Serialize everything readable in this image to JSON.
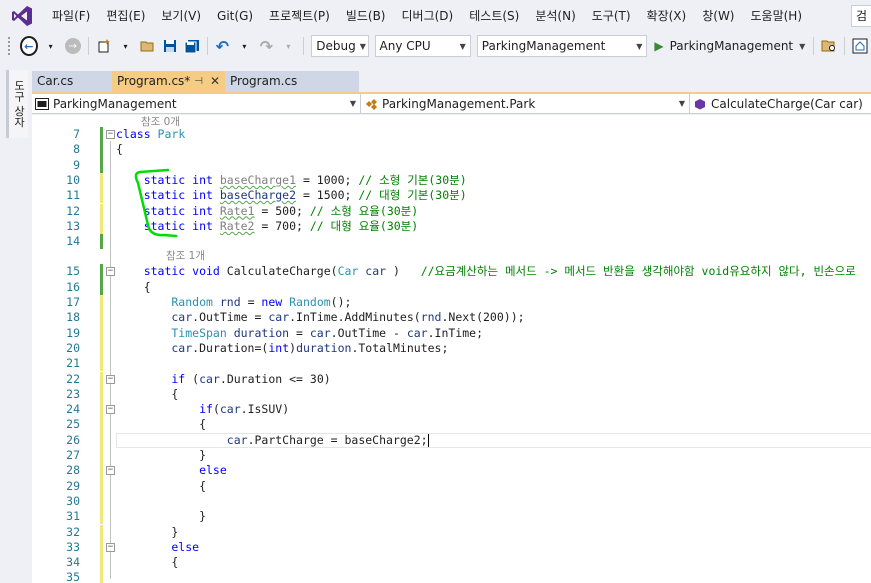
{
  "menubar": {
    "items": [
      "파일(F)",
      "편집(E)",
      "보기(V)",
      "Git(G)",
      "프로젝트(P)",
      "빌드(B)",
      "디버그(D)",
      "테스트(S)",
      "분석(N)",
      "도구(T)",
      "확장(X)",
      "창(W)",
      "도움말(H)"
    ],
    "search_text": "검"
  },
  "toolbar": {
    "configuration": "Debug",
    "platform": "Any CPU",
    "startup_project": "ParkingManagement",
    "run_label": "ParkingManagement"
  },
  "side_strip": {
    "label": "도구 상자"
  },
  "tabs": [
    {
      "label": "Car.cs",
      "active": false
    },
    {
      "label": "Program.cs*",
      "active": true
    },
    {
      "label": "Program.cs",
      "active": false
    }
  ],
  "navbar": {
    "project": "ParkingManagement",
    "type": "ParkingManagement.Park",
    "member": "CalculateCharge(Car car)"
  },
  "editor": {
    "lens_refs_0": "참조 0개",
    "lens_refs_1": "참조 1개",
    "lines": [
      {
        "n": "7",
        "fold": "−",
        "mark": "saved",
        "segs": [
          [
            "kw",
            "class "
          ],
          [
            "ty",
            "Park"
          ]
        ]
      },
      {
        "n": "8",
        "fold": "",
        "mark": "saved",
        "segs": [
          [
            "",
            "{"
          ]
        ]
      },
      {
        "n": "9",
        "fold": "",
        "mark": "saved",
        "segs": []
      },
      {
        "n": "10",
        "fold": "",
        "mark": "mod",
        "segs": [
          [
            "kw",
            "    static int "
          ],
          [
            "fd sq",
            "baseCharge1"
          ],
          [
            "",
            " = 1000; "
          ],
          [
            "cm",
            "// 소형 기본(30분)"
          ]
        ]
      },
      {
        "n": "11",
        "fold": "",
        "mark": "mod",
        "segs": [
          [
            "kw",
            "    static int "
          ],
          [
            "id sq",
            "baseCharge2"
          ],
          [
            "",
            " = 1500; "
          ],
          [
            "cm",
            "// 대형 기본(30분)"
          ]
        ]
      },
      {
        "n": "12",
        "fold": "",
        "mark": "mod",
        "segs": [
          [
            "kw",
            "    static int "
          ],
          [
            "fd sq",
            "Rate1"
          ],
          [
            "",
            " = 500; "
          ],
          [
            "cm",
            "// 소형 요율(30분)"
          ]
        ]
      },
      {
        "n": "13",
        "fold": "",
        "mark": "mod",
        "segs": [
          [
            "kw",
            "    static int "
          ],
          [
            "fd sq",
            "Rate2"
          ],
          [
            "",
            " = 700; "
          ],
          [
            "cm",
            "// 대형 요율(30분)"
          ]
        ]
      },
      {
        "n": "14",
        "fold": "",
        "mark": "saved",
        "segs": []
      },
      {
        "n": "15",
        "fold": "−",
        "mark": "saved",
        "segs": [
          [
            "kw",
            "    static void "
          ],
          [
            "",
            "CalculateCharge("
          ],
          [
            "ty",
            "Car"
          ],
          [
            "",
            " "
          ],
          [
            "id",
            "car"
          ],
          [
            "",
            " )   "
          ],
          [
            "cm",
            "//요금계산하는 메서드 -> 메서드 반환을 생각해야함 void유요하지 않다, 빈손으로"
          ]
        ]
      },
      {
        "n": "16",
        "fold": "",
        "mark": "saved",
        "segs": [
          [
            "",
            "    {"
          ]
        ]
      },
      {
        "n": "17",
        "fold": "",
        "mark": "mod",
        "segs": [
          [
            "ty",
            "        Random "
          ],
          [
            "id",
            "rnd"
          ],
          [
            "",
            " = "
          ],
          [
            "kw",
            "new "
          ],
          [
            "ty",
            "Random"
          ],
          [
            "",
            "();"
          ]
        ]
      },
      {
        "n": "18",
        "fold": "",
        "mark": "mod",
        "segs": [
          [
            "id",
            "        car"
          ],
          [
            "",
            ".OutTime = "
          ],
          [
            "id",
            "car"
          ],
          [
            "",
            ".InTime.AddMinutes("
          ],
          [
            "id",
            "rnd"
          ],
          [
            "",
            ".Next(200));"
          ]
        ]
      },
      {
        "n": "19",
        "fold": "",
        "mark": "mod",
        "segs": [
          [
            "ty",
            "        TimeSpan "
          ],
          [
            "id",
            "duration"
          ],
          [
            "",
            " = "
          ],
          [
            "id",
            "car"
          ],
          [
            "",
            ".OutTime - "
          ],
          [
            "id",
            "car"
          ],
          [
            "",
            ".InTime;"
          ]
        ]
      },
      {
        "n": "20",
        "fold": "",
        "mark": "mod",
        "segs": [
          [
            "id",
            "        car"
          ],
          [
            "",
            ".Duration=("
          ],
          [
            "kw",
            "int"
          ],
          [
            "",
            ")"
          ],
          [
            "id",
            "duration"
          ],
          [
            "",
            ".TotalMinutes;"
          ]
        ]
      },
      {
        "n": "21",
        "fold": "",
        "mark": "mod",
        "segs": []
      },
      {
        "n": "22",
        "fold": "−",
        "mark": "mod",
        "segs": [
          [
            "kw",
            "        if "
          ],
          [
            "",
            "("
          ],
          [
            "id",
            "car"
          ],
          [
            "",
            ".Duration <= 30)"
          ]
        ]
      },
      {
        "n": "23",
        "fold": "",
        "mark": "mod",
        "segs": [
          [
            "",
            "        {"
          ]
        ]
      },
      {
        "n": "24",
        "fold": "−",
        "mark": "mod",
        "segs": [
          [
            "kw",
            "            if"
          ],
          [
            "",
            "("
          ],
          [
            "id",
            "car"
          ],
          [
            "",
            ".IsSUV)"
          ]
        ]
      },
      {
        "n": "25",
        "fold": "",
        "mark": "mod",
        "segs": [
          [
            "",
            "            {"
          ]
        ]
      },
      {
        "n": "26",
        "fold": "",
        "mark": "mod",
        "segs": [
          [
            "id",
            "                car"
          ],
          [
            "",
            ".PartCharge = baseCharge2;"
          ]
        ]
      },
      {
        "n": "27",
        "fold": "",
        "mark": "mod",
        "segs": [
          [
            "",
            "            }"
          ]
        ]
      },
      {
        "n": "28",
        "fold": "−",
        "mark": "mod",
        "segs": [
          [
            "kw",
            "            else"
          ]
        ]
      },
      {
        "n": "29",
        "fold": "",
        "mark": "mod",
        "segs": [
          [
            "",
            "            {"
          ]
        ]
      },
      {
        "n": "30",
        "fold": "",
        "mark": "mod",
        "segs": []
      },
      {
        "n": "31",
        "fold": "",
        "mark": "mod",
        "segs": [
          [
            "",
            "            }"
          ]
        ]
      },
      {
        "n": "32",
        "fold": "",
        "mark": "mod",
        "segs": [
          [
            "",
            "        }"
          ]
        ]
      },
      {
        "n": "33",
        "fold": "−",
        "mark": "mod",
        "segs": [
          [
            "kw",
            "        else"
          ]
        ]
      },
      {
        "n": "34",
        "fold": "",
        "mark": "mod",
        "segs": [
          [
            "",
            "        {"
          ]
        ]
      },
      {
        "n": "35",
        "fold": "",
        "mark": "mod",
        "segs": []
      }
    ]
  },
  "colors": {
    "accent": "#5c2d91",
    "active_tab": "#f5cc84",
    "keyword": "#0000ff",
    "type": "#2b91af",
    "comment": "#008000",
    "annotation": "#00dd00"
  }
}
